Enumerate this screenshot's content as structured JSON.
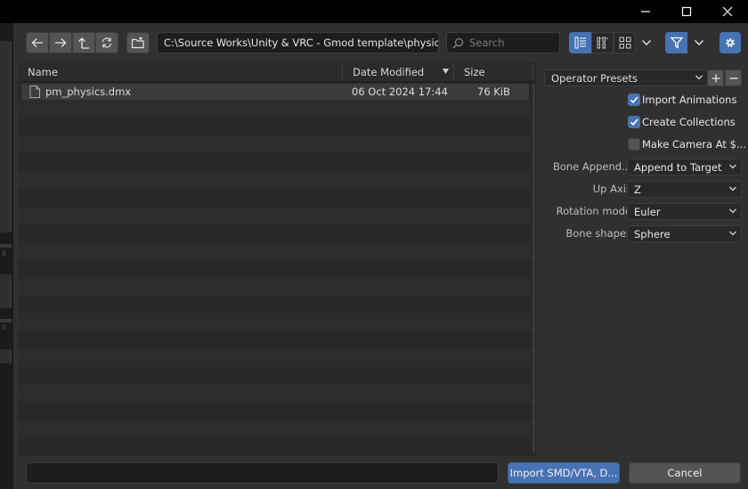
{
  "window": {
    "minimize_icon": "minimize-icon",
    "maximize_icon": "maximize-icon",
    "close_icon": "close-icon"
  },
  "toolbar": {
    "path": "C:\\Source Works\\Unity & VRC - Gmod template\\physic ...",
    "search_placeholder": "Search"
  },
  "file_list": {
    "columns": {
      "name": "Name",
      "date": "Date Modified",
      "size": "Size"
    },
    "files": [
      {
        "name": "pm_physics.dmx",
        "date": "06 Oct 2024 17:44",
        "size": "76 KiB"
      }
    ]
  },
  "options": {
    "presets_label": "Operator Presets",
    "import_animations": {
      "label": "Import Animations",
      "checked": true
    },
    "create_collections": {
      "label": "Create Collections",
      "checked": true
    },
    "make_camera": {
      "label": "Make Camera At $...",
      "checked": false
    },
    "bone_append": {
      "label": "Bone Append...",
      "value": "Append to Target"
    },
    "up_axis": {
      "label": "Up Axis",
      "value": "Z"
    },
    "rotation_mode": {
      "label": "Rotation mode",
      "value": "Euler"
    },
    "bone_shapes": {
      "label": "Bone shapes",
      "value": "Sphere"
    }
  },
  "footer": {
    "filename_value": "",
    "import_label": "Import SMD/VTA, D...",
    "cancel_label": "Cancel"
  },
  "colors": {
    "accent": "#4772b3",
    "panel": "#303030",
    "list_bg": "#282828"
  }
}
